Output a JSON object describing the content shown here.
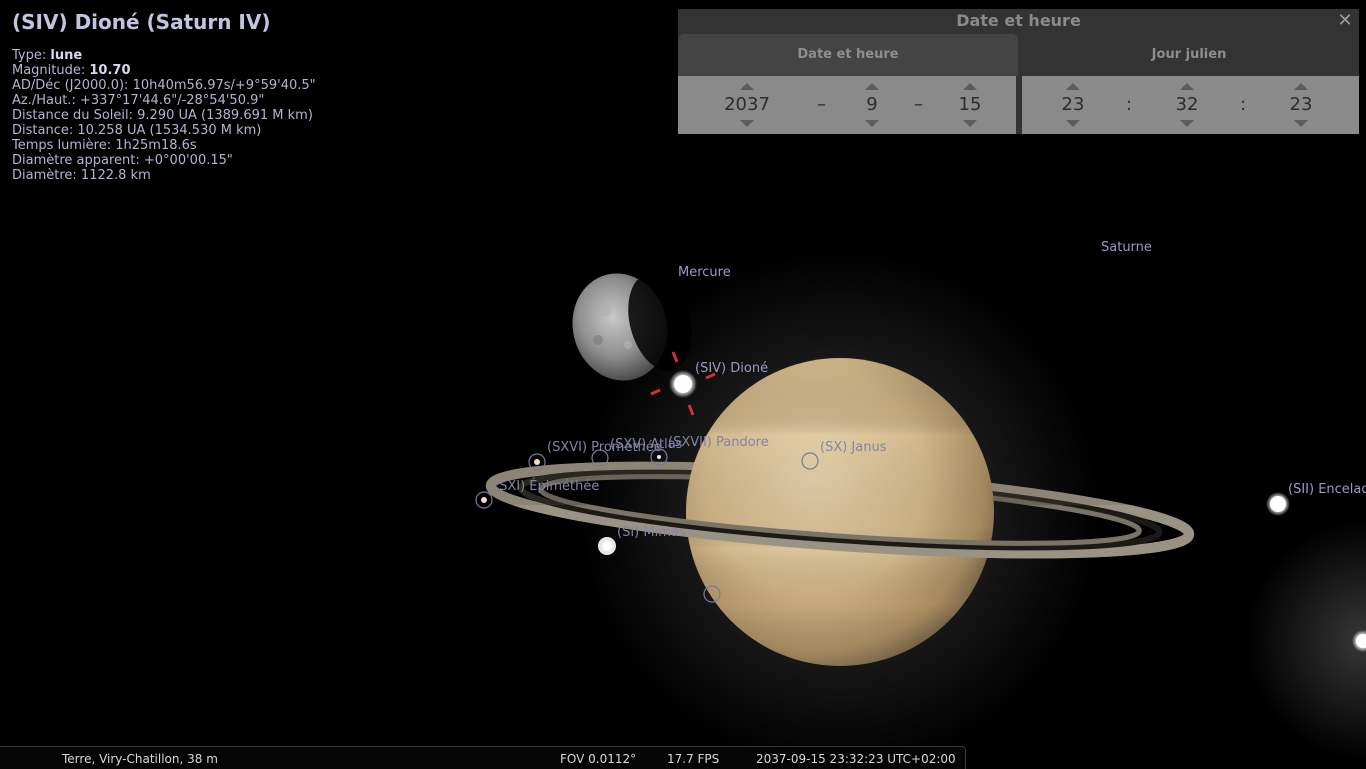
{
  "object_info": {
    "title": "(SIV) Dioné (Saturn IV)",
    "rows": [
      {
        "label": "Type: ",
        "value": "lune",
        "bold": true
      },
      {
        "label": "Magnitude: ",
        "value": "10.70",
        "bold": true
      },
      {
        "label": "AD/Déc (J2000.0): ",
        "value": "10h40m56.97s/+9°59'40.5\""
      },
      {
        "label": "Az./Haut.: ",
        "value": "+337°17'44.6\"/-28°54'50.9\""
      },
      {
        "label": "Distance du Soleil: ",
        "value": "9.290 UA (1389.691 M km)"
      },
      {
        "label": "Distance: ",
        "value": "10.258 UA (1534.530 M km)"
      },
      {
        "label": "Temps lumière: ",
        "value": "1h25m18.6s"
      },
      {
        "label": "Diamètre apparent: ",
        "value": "+0°00'00.15\""
      },
      {
        "label": "Diamètre: ",
        "value": "1122.8 km"
      }
    ]
  },
  "sky_labels": {
    "mercure": "Mercure",
    "saturne": "Saturne",
    "dione": "(SIV) Dioné",
    "promethee": "(SXVI) Prométhée",
    "atlas": "(SXV) Atlas",
    "pandore": "(SXVII) Pandore",
    "janus": "(SX) Janus",
    "epimethee": "(SXI) Épiméthée",
    "mimas": "(SI) Mimas",
    "encelade": "(SII) Encelade"
  },
  "datetime_window": {
    "title": "Date et heure",
    "close_glyph": "✕",
    "tabs": [
      "Date et heure",
      "Jour julien"
    ],
    "active_tab": 0,
    "date": {
      "year": "2037",
      "month": "9",
      "day": "15",
      "sep": "–"
    },
    "time": {
      "hour": "23",
      "minute": "32",
      "second": "23",
      "sep": ":"
    }
  },
  "status_bar": {
    "location": "Terre, Viry-Chatillon, 38 m",
    "fov": "FOV 0.0112°",
    "fps": "17.7 FPS",
    "datetime": "2037-09-15 23:32:23 UTC+02:00"
  },
  "colors": {
    "label": "#9a9ac4",
    "pointer": "#d03030",
    "saturn": "#d9c39c",
    "mercury": "#9a9a9a"
  }
}
